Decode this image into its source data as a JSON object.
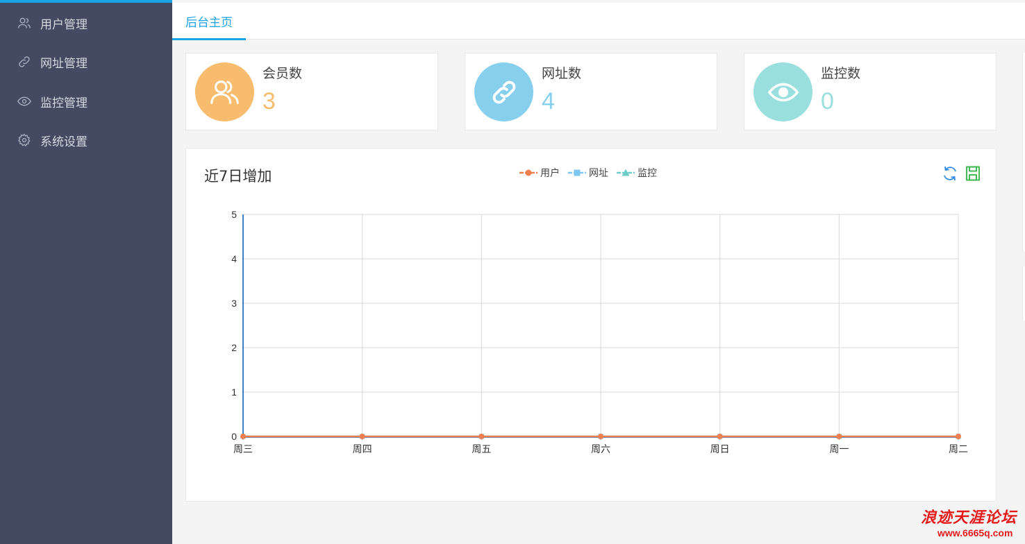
{
  "sidebar": {
    "items": [
      {
        "label": "用户管理",
        "icon": "users-icon"
      },
      {
        "label": "网址管理",
        "icon": "link-icon"
      },
      {
        "label": "监控管理",
        "icon": "eye-icon"
      },
      {
        "label": "系统设置",
        "icon": "gear-icon"
      }
    ]
  },
  "tabs": [
    {
      "label": "后台主页",
      "active": true
    }
  ],
  "cards": [
    {
      "title": "会员数",
      "value": "3",
      "color": "#f8bc6f",
      "icon": "users-icon"
    },
    {
      "title": "网址数",
      "value": "4",
      "color": "#86d0ee",
      "icon": "link-icon"
    },
    {
      "title": "监控数",
      "value": "0",
      "color": "#98dfde",
      "icon": "eye-icon"
    }
  ],
  "chart_panel": {
    "title": "近7日增加",
    "tools": [
      "refresh-icon",
      "save-icon"
    ]
  },
  "chart_data": {
    "type": "line",
    "title": "近7日增加",
    "categories": [
      "周三",
      "周四",
      "周五",
      "周六",
      "周日",
      "周一",
      "周二"
    ],
    "series": [
      {
        "name": "用户",
        "values": [
          0,
          0,
          0,
          0,
          0,
          0,
          0
        ],
        "color": "#f07f4f",
        "marker": "circle"
      },
      {
        "name": "网址",
        "values": [
          0,
          0,
          0,
          0,
          0,
          0,
          0
        ],
        "color": "#7ec7f0",
        "marker": "square"
      },
      {
        "name": "监控",
        "values": [
          0,
          0,
          0,
          0,
          0,
          0,
          0
        ],
        "color": "#6dcdc8",
        "marker": "triangle"
      }
    ],
    "ylim": [
      0,
      5
    ],
    "yticks": [
      0,
      1,
      2,
      3,
      4,
      5
    ],
    "grid": true,
    "legend": "top-center"
  },
  "watermark": {
    "text": "浪迹天涯论坛",
    "url": "www.6665q.com"
  }
}
